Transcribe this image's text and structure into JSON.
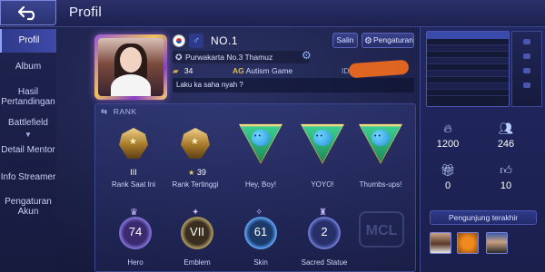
{
  "header": {
    "title": "Profil",
    "back_icon": "back-arrow-icon"
  },
  "sidebar": {
    "items": [
      {
        "label": "Profil",
        "active": true
      },
      {
        "label": "Album"
      },
      {
        "label": "Hasil Pertandingan"
      },
      {
        "label": "Battlefield",
        "expandable": true
      },
      {
        "label": "Detail Mentor"
      },
      {
        "label": "Info Streamer"
      },
      {
        "label": "Pengaturan Akun"
      }
    ]
  },
  "profile": {
    "rank_no": "NO.1",
    "title": "Purwakarta No.3 Thamuz",
    "level": "34",
    "squad_tag": "AG",
    "squad_name": "Autism Game",
    "id_prefix": "ID:",
    "bio": "Laku ka saha nyah ?",
    "copy_label": "Salin",
    "settings_label": "Pengaturan"
  },
  "rank": {
    "header": "RANK",
    "current": {
      "tier": "III",
      "label": "Rank Saat Ini"
    },
    "highest": {
      "stars": "39",
      "label": "Rank Tertinggi"
    },
    "emotes": [
      {
        "label": "Hey, Boy!"
      },
      {
        "label": "YOYO!"
      },
      {
        "label": "Thumbs-ups!"
      }
    ],
    "stats": [
      {
        "value": "74",
        "label": "Hero"
      },
      {
        "value": "VII",
        "label": "Emblem"
      },
      {
        "value": "61",
        "label": "Skin"
      },
      {
        "value": "2",
        "label": "Sacred Statue"
      }
    ],
    "logo_text": "MCL"
  },
  "right_panel": {
    "popularity": "1200",
    "followers": "246",
    "gifts": "0",
    "likes": "10",
    "visitors_label": "Pengunjung terakhir"
  },
  "colors": {
    "background": "#1a1f45",
    "accent": "#3e4aa8",
    "gold": "#e2b94c",
    "redaction": "#f06a1e"
  }
}
